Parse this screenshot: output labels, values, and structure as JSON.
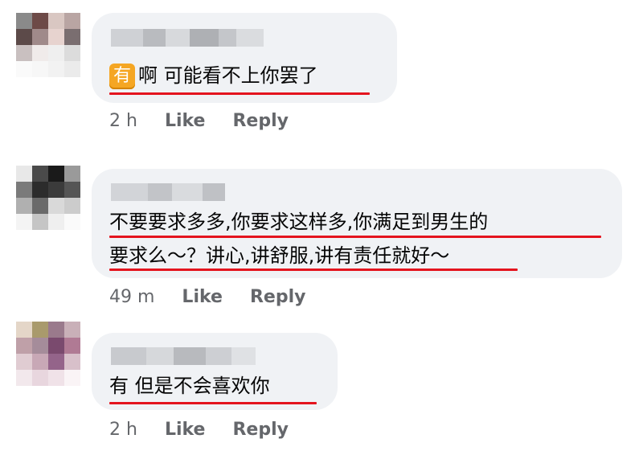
{
  "comments": [
    {
      "badge": "有",
      "text": "啊 可能看不上你罢了",
      "time": "2 h",
      "like": "Like",
      "reply": "Reply"
    },
    {
      "line1": "不要要求多多,你要求这样多,你满足到男生的",
      "line2": "要求么～？讲心,讲舒服,讲有责任就好～",
      "time": "49 m",
      "like": "Like",
      "reply": "Reply"
    },
    {
      "text": "有 但是不会喜欢你",
      "time": "2 h",
      "like": "Like",
      "reply": "Reply"
    }
  ],
  "annotation_color": "#e4141e"
}
